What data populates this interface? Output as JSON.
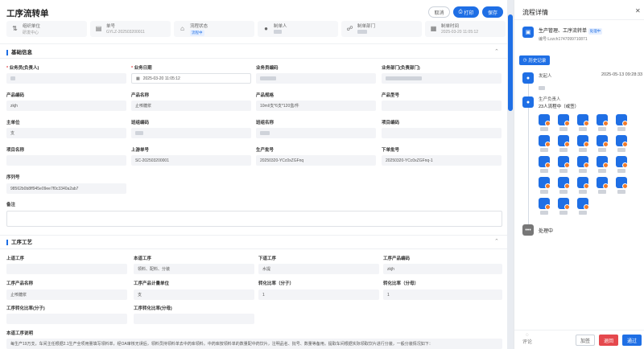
{
  "page": {
    "title": "工序流转单"
  },
  "toolbar": {
    "cancel": "取消",
    "print": "打印",
    "save": "保存"
  },
  "info_cards": [
    {
      "icon": "org-icon",
      "label": "组织单位",
      "value": "研发中心"
    },
    {
      "icon": "doc-icon",
      "label": "单号",
      "value": "GYLZ-202503200011"
    },
    {
      "icon": "flow-icon",
      "label": "流程状态",
      "value": "流程中"
    },
    {
      "icon": "user-icon",
      "label": "制单人",
      "value": ""
    },
    {
      "icon": "dept-icon",
      "label": "制单部门",
      "value": ""
    },
    {
      "icon": "calendar-icon",
      "label": "制单时间",
      "value": "2025-03-20 11:05:12"
    }
  ],
  "basic": {
    "section": "基础信息",
    "salesman_label": "业务员(负责人)",
    "bizdate_label": "业务日期",
    "bizdate_value": "2025-03-20 11:05:12",
    "salesman_code_label": "业务员编码",
    "dept_label": "业务部门(负责部门)",
    "product_code_label": "产品编码",
    "product_code_value": "zkjh",
    "product_name_label": "产品名称",
    "product_name_value": "止咳糖浆",
    "spec_label": "产品规格",
    "spec_value": "10ml/支*6支*120盒/件",
    "model_label": "产品型号",
    "unit_label": "主单位",
    "unit_value": "支",
    "shift_code_label": "班组编码",
    "shift_name_label": "班组名称",
    "project_code_label": "项目编码",
    "project_name_label": "项目名称",
    "upstream_label": "上游单号",
    "upstream_value": "SC-202503200001",
    "batch_label": "生产批号",
    "batch_value": "20250320-YCc0xZGFnq",
    "lower_batch_label": "下单批号",
    "lower_batch_value": "20250320-YCc0xZGFnq-1",
    "serial_label": "序列号",
    "serial_value": "98562b0b8ff945e09ee7f0c3340a2ab7",
    "remark_label": "备注"
  },
  "process": {
    "section": "工序工艺",
    "prev_label": "上道工序",
    "cur_label": "本道工序",
    "cur_value": "领料、配料、分装",
    "next_label": "下道工序",
    "next_value": "水提",
    "pcode_label": "工序产品编码",
    "pcode_value": "zkjh",
    "pname_label": "工序产品名称",
    "pname_value": "止咳糖浆",
    "punit_label": "工序产品计量单位",
    "punit_value": "支",
    "ratio_num_label": "转化比率（分子）",
    "ratio_num_value": "1",
    "ratio_den_label": "转化比率（分母）",
    "ratio_den_value": "1",
    "pratio_num_label": "工序转化比率(分子)",
    "pratio_den_label": "工序转化比率(分母)",
    "desc_label": "本道工序说明",
    "desc_value": "每生产19万支，车间主任根据2.1生产全项用量填写领料单，经OA审核无误后，领料员持领料单去中药库领料。中药库按领料单的数量配中药饮片，注明品名、批号、数量等备用。提取车间根据实际领取饮片进行分装，一般分装情况如下："
  },
  "panel": {
    "title": "流程详情",
    "workflow_name": "生产管理、工序流转单",
    "workflow_status": "处理中",
    "workflow_no": "编号:Lzzch1747099710871",
    "history_button": "历史记录",
    "initiator_label": "发起人",
    "initiator_time": "2025-05-13 09:28:33",
    "node_name": "生产负责人",
    "node_summary": "23人流程中（或签）",
    "processing_label": "处理中",
    "comment_label": "评论",
    "btn_add": "加签",
    "btn_return": "退回",
    "btn_pass": "通过"
  },
  "colors": {
    "accent": "#1f6fe5",
    "danger": "#e5484d",
    "warn": "#f07b2b"
  }
}
